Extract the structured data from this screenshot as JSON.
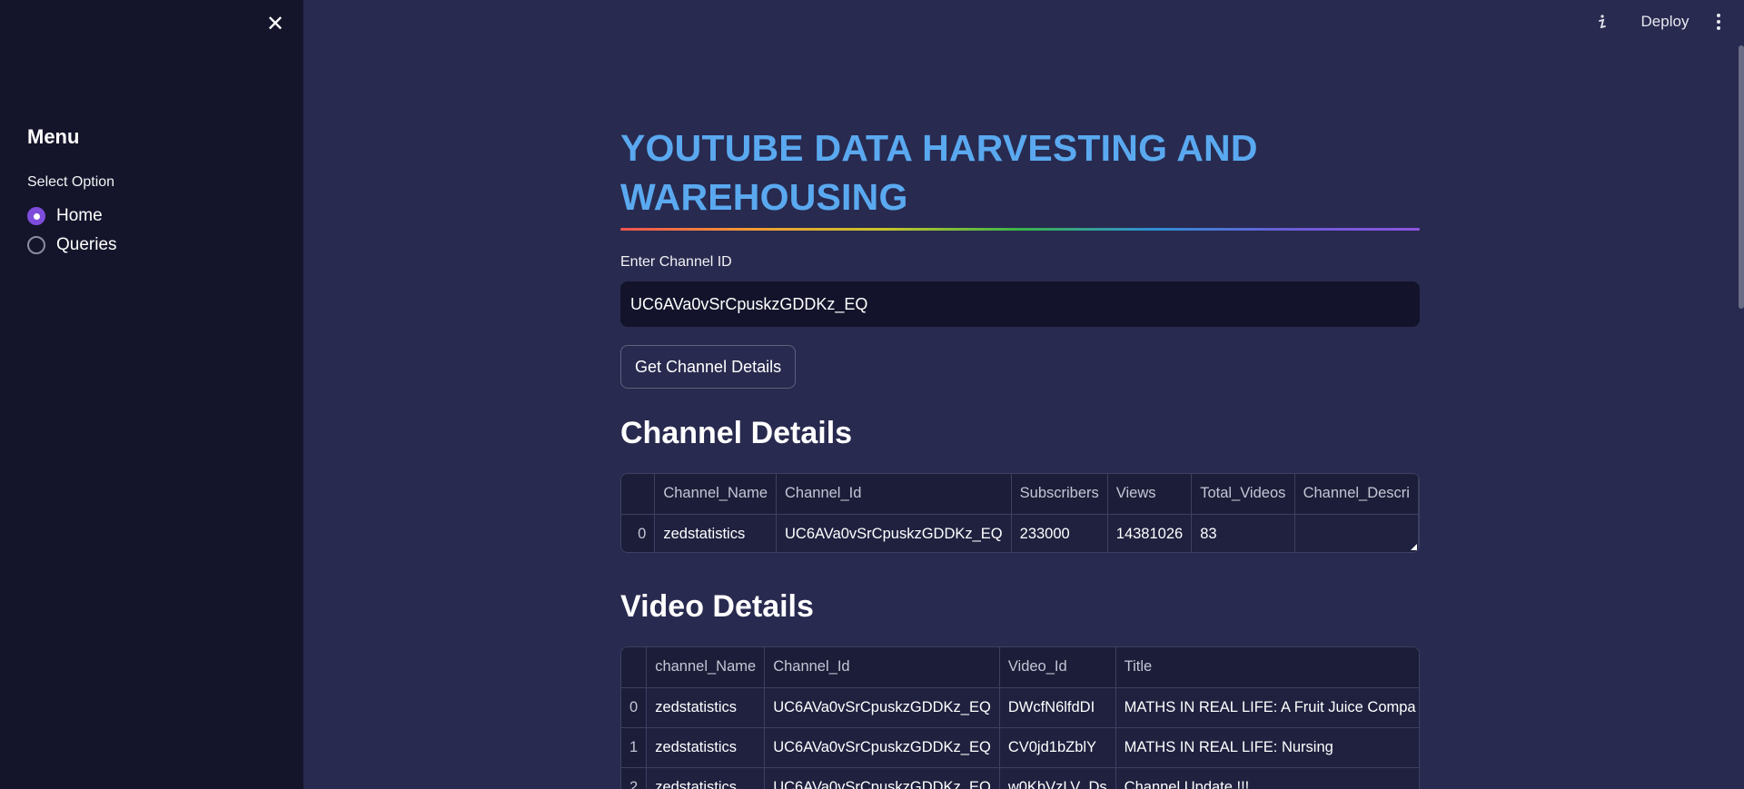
{
  "sidebar": {
    "menu_title": "Menu",
    "select_label": "Select Option",
    "options": [
      "Home",
      "Queries"
    ],
    "selected": "Home"
  },
  "topbar": {
    "deploy_label": "Deploy"
  },
  "main": {
    "title": "YOUTUBE DATA HARVESTING AND WAREHOUSING",
    "input_label": "Enter Channel ID",
    "input_value": "UC6AVa0vSrCpuskzGDDKz_EQ",
    "button_label": "Get Channel Details",
    "channel_section_title": "Channel Details",
    "video_section_title": "Video Details"
  },
  "channel_table": {
    "columns": [
      "Channel_Name",
      "Channel_Id",
      "Subscribers",
      "Views",
      "Total_Videos",
      "Channel_Descri"
    ],
    "rows": [
      [
        "0",
        "zedstatistics",
        "UC6AVa0vSrCpuskzGDDKz_EQ",
        "233000",
        "14381026",
        "83",
        ""
      ]
    ]
  },
  "video_table": {
    "columns": [
      "channel_Name",
      "Channel_Id",
      "Video_Id",
      "Title"
    ],
    "rows": [
      [
        "0",
        "zedstatistics",
        "UC6AVa0vSrCpuskzGDDKz_EQ",
        "DWcfN6lfdDI",
        "MATHS IN REAL LIFE: A Fruit Juice Compa"
      ],
      [
        "1",
        "zedstatistics",
        "UC6AVa0vSrCpuskzGDDKz_EQ",
        "CV0jd1bZblY",
        "MATHS IN REAL LIFE: Nursing"
      ],
      [
        "2",
        "zedstatistics",
        "UC6AVa0vSrCpuskzGDDKz_EQ",
        "w0KbVzLV_Ds",
        "Channel Update !!!"
      ]
    ]
  },
  "colors": {
    "background": "#282a4f",
    "sidebar": "#14152a",
    "title": "#5aa9f0",
    "radio_accent": "#7d4cdb"
  }
}
